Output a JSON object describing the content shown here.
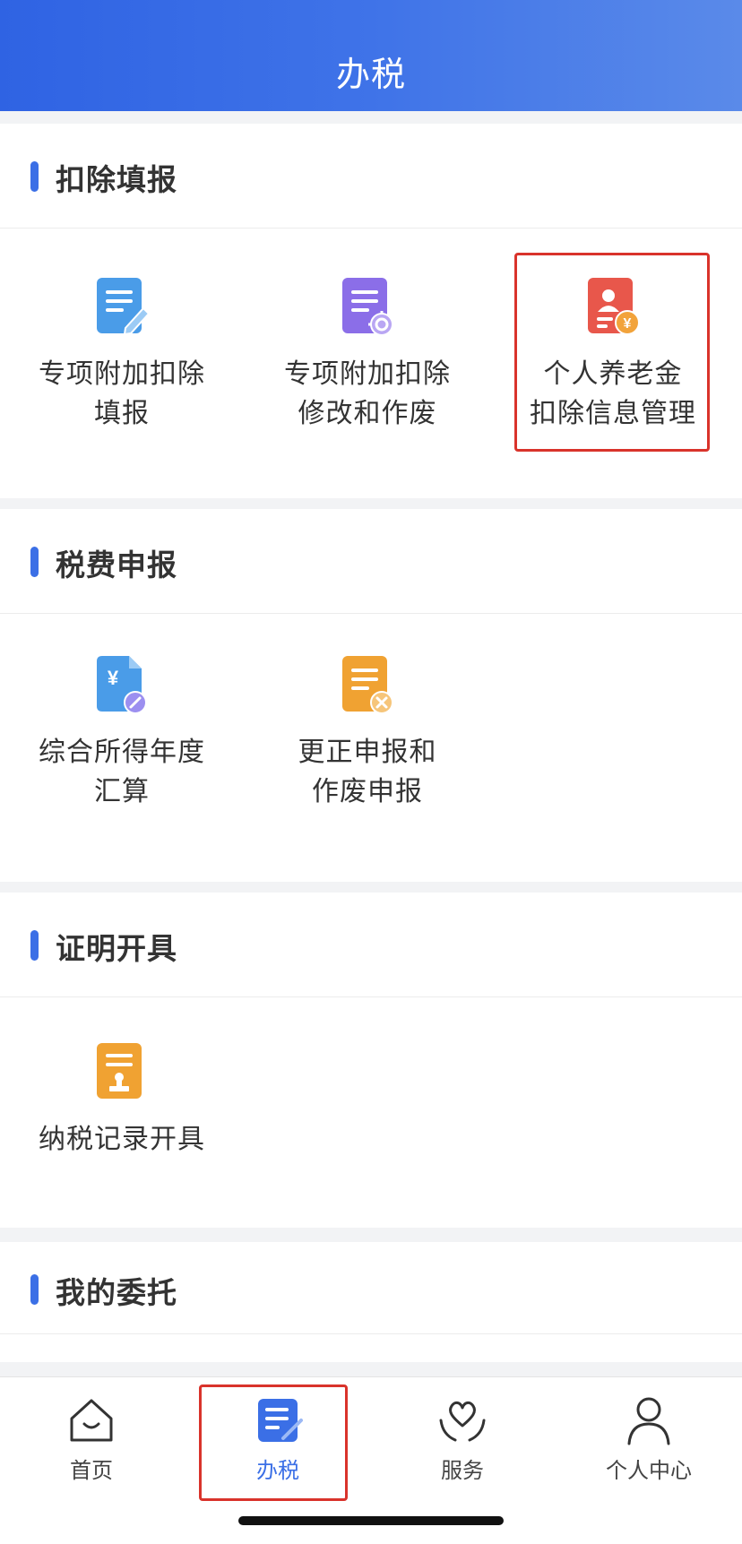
{
  "header": {
    "title": "办税"
  },
  "sections": [
    {
      "title": "扣除填报",
      "tiles": [
        {
          "label": "专项附加扣除\n填报",
          "icon": "document-edit-icon",
          "color": "#4a9ce8"
        },
        {
          "label": "专项附加扣除\n修改和作废",
          "icon": "document-settings-icon",
          "color": "#8b6ee8"
        },
        {
          "label": "个人养老金\n扣除信息管理",
          "icon": "pension-yuan-icon",
          "color": "#e8574b"
        }
      ]
    },
    {
      "title": "税费申报",
      "tiles": [
        {
          "label": "综合所得年度\n汇算",
          "icon": "yuan-document-edit-icon",
          "yuan": "¥",
          "color": "#4a9ce8"
        },
        {
          "label": "更正申报和\n作废申报",
          "icon": "document-cancel-icon",
          "color": "#f0a232"
        }
      ]
    },
    {
      "title": "证明开具",
      "tiles": [
        {
          "label": "纳税记录开具",
          "icon": "document-stamp-icon",
          "color": "#f0a232"
        }
      ]
    },
    {
      "title": "我的委托",
      "tiles": []
    }
  ],
  "tabbar": {
    "items": [
      {
        "label": "首页",
        "icon": "home-icon"
      },
      {
        "label": "办税",
        "icon": "tax-document-icon",
        "active": true
      },
      {
        "label": "服务",
        "icon": "service-heart-icon"
      },
      {
        "label": "个人中心",
        "icon": "user-icon"
      }
    ]
  },
  "colors": {
    "accent": "#3b6fe6",
    "highlight": "#d9332b",
    "header_gradient_start": "#2f63e3",
    "header_gradient_end": "#5a8ae9"
  },
  "pension_icon_symbol": "¥"
}
